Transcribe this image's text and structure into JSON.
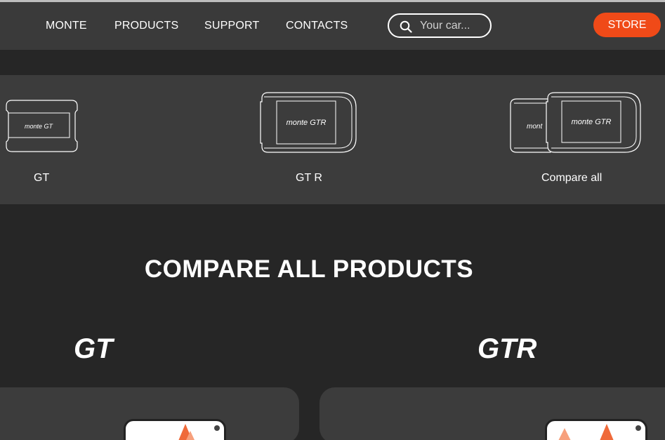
{
  "header": {
    "nav": [
      "MONTE",
      "PRODUCTS",
      "SUPPORT",
      "CONTACTS"
    ],
    "search": {
      "placeholder": "Your car..."
    },
    "store_label": "STORE"
  },
  "products_bar": {
    "items": [
      {
        "label": "GT",
        "device_logo": "monte GT"
      },
      {
        "label": "GT R",
        "device_logo": "monte GTR"
      },
      {
        "label": "Compare all",
        "device_logo": "monte GTR"
      }
    ]
  },
  "compare": {
    "title": "COMPARE ALL PRODUCTS",
    "columns": [
      {
        "brand": "GT"
      },
      {
        "brand": "GTR"
      }
    ]
  },
  "colors": {
    "accent": "#f04a18",
    "background": "#262626",
    "header": "#3a3a3a",
    "panel": "#3c3c3c"
  }
}
